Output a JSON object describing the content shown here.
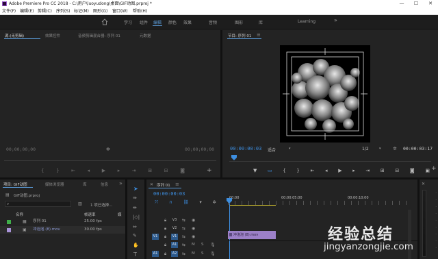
{
  "titlebar": {
    "title": "Adobe Premiere Pro CC 2018 - C:\\用户\\luoyudong\\桌面\\GIF动图.prproj *",
    "minimize": "—",
    "maximize": "☐",
    "close": "✕"
  },
  "menubar": {
    "items": [
      "文件(F)",
      "编辑(E)",
      "剪辑(C)",
      "序列(S)",
      "标记(M)",
      "图形(G)",
      "窗口(W)",
      "帮助(H)"
    ]
  },
  "workspaces": {
    "home_icon": "home-icon",
    "items": [
      "学习",
      "组件",
      "编辑",
      "颜色",
      "效果",
      "音频",
      "图形",
      "库",
      "Learning"
    ],
    "active": "编辑",
    "more": "»"
  },
  "source_panel": {
    "tabs": [
      "源:(无剪辑)",
      "效果控件",
      "音频剪辑混合器: 序列 01",
      "元数据"
    ],
    "menu_icon": "≡",
    "timecode_left": "00;00;00;00",
    "timecode_right": "00;00;00;00"
  },
  "program_monitor": {
    "title": "节目: 序列 01",
    "menu_icon": "≡",
    "timecode": "00:00:00:03",
    "fit": "适合",
    "resolution": "1/2",
    "duration": "00:00:03:17"
  },
  "project_panel": {
    "tabs": [
      "项目: GIF动图",
      "媒体浏览器",
      "库",
      "信息"
    ],
    "more": "»",
    "file": "GIF动图.prproj",
    "selection": "1 项已选择...",
    "col_name": "名称",
    "col_fps": "帧速率",
    "col_media": "媒",
    "rows": [
      {
        "name": "序列 01",
        "fps": "25.00 fps",
        "color": "#3fae49"
      },
      {
        "name": "冲泡泡 (8).mov",
        "fps": "30.00 fps",
        "color": "#a993d9"
      }
    ]
  },
  "timeline": {
    "title": "序列 01",
    "menu_icon": "≡",
    "timecode": "00:00:00:03",
    "ruler": [
      "00:00",
      "00:00:05:00",
      "00:00:10:00"
    ],
    "video_tracks": [
      "V3",
      "V2",
      "V1"
    ],
    "audio_tracks": [
      "A1",
      "A2"
    ],
    "source_patch_v": "V1",
    "source_patch_a": "A1",
    "clip_label": "冲泡泡 (8).mov"
  },
  "watermark": {
    "cn": "经验总结",
    "en": "jingyanzongjie.com"
  },
  "colors": {
    "accent": "#3d8ee0",
    "clip": "#9c80c8",
    "sequence": "#3fae49"
  }
}
